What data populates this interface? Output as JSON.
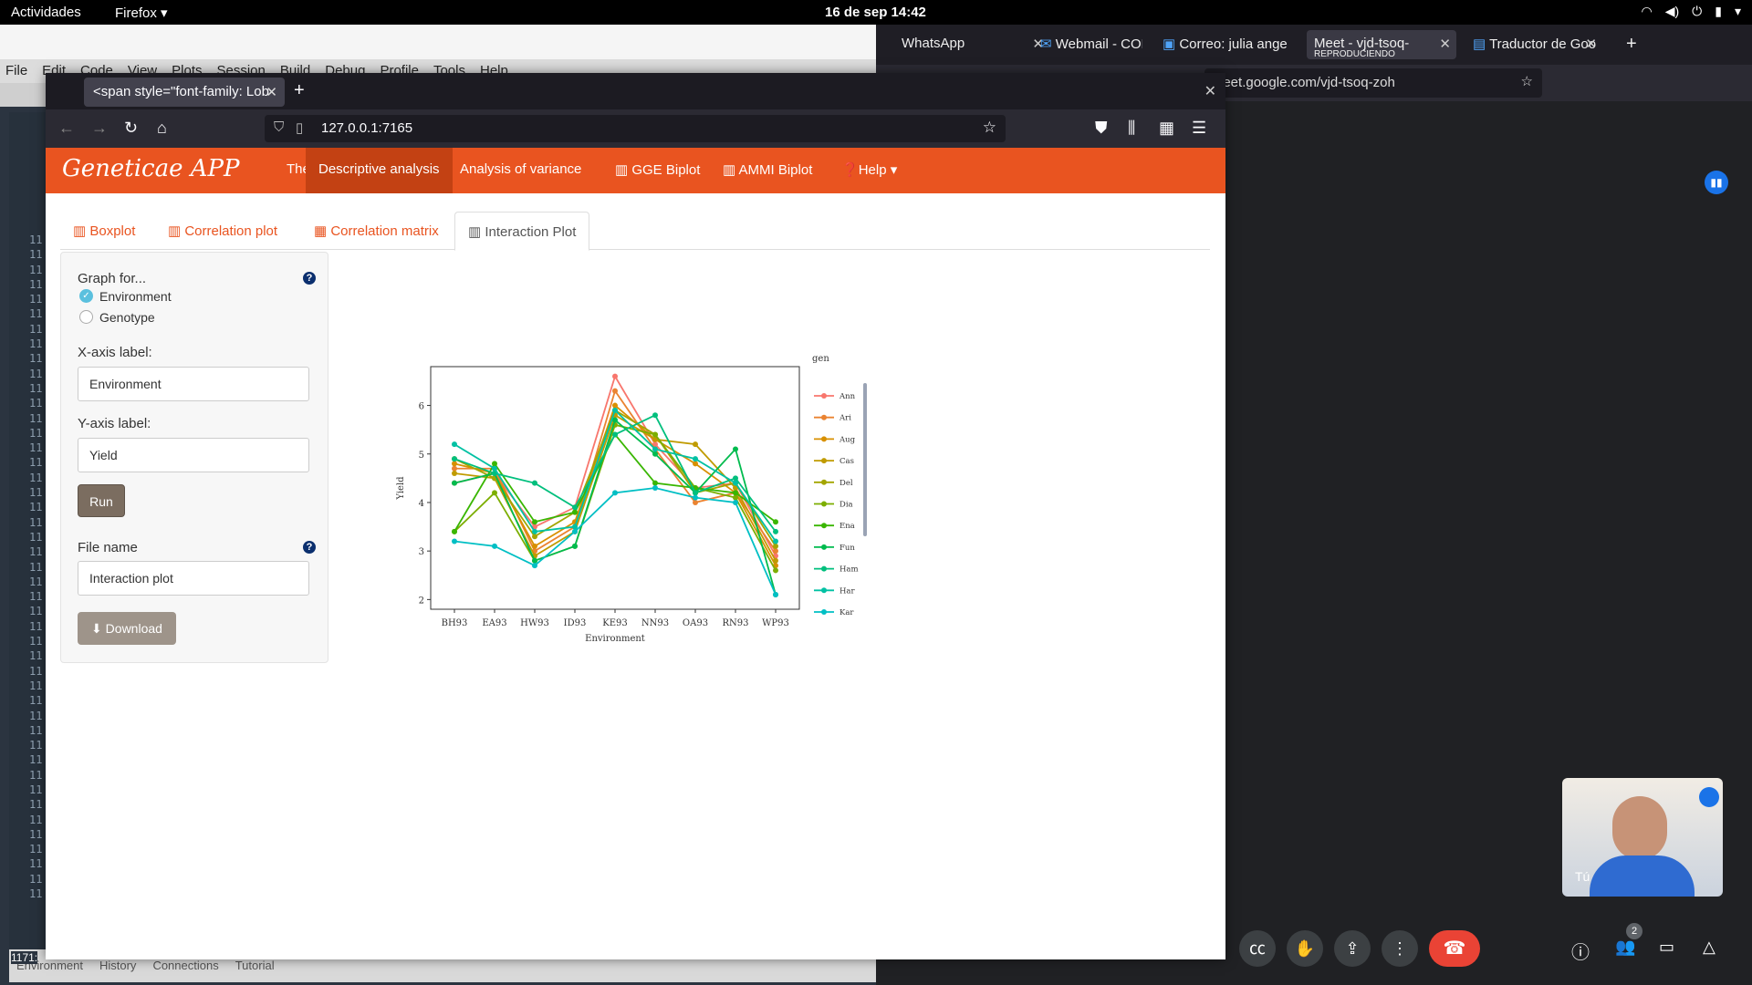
{
  "topbar": {
    "activities": "Actividades",
    "app": "Firefox ▾",
    "clock": "16 de sep  14:42"
  },
  "rstudio": {
    "menu": [
      "File",
      "Edit",
      "Code",
      "View",
      "Plots",
      "Session",
      "Build",
      "Debug",
      "Profile",
      "Tools",
      "Help"
    ],
    "bottom_tabs": [
      "Environment",
      "History",
      "Connections",
      "Tutorial"
    ],
    "line_prefix": "11",
    "line_counter": "1171:"
  },
  "meet": {
    "tabs": [
      {
        "label": "WhatsApp"
      },
      {
        "label": "Webmail - CONI"
      },
      {
        "label": "Correo: julia ange"
      },
      {
        "label": "Meet - vjd-tsoq-",
        "sub": "REPRODUCIENDO"
      },
      {
        "label": "Traductor de Goo"
      }
    ],
    "url": "neet.google.com/vjd-tsoq-zoh",
    "self_label": "Tú",
    "participants_badge": "2"
  },
  "browser": {
    "tab_title": "<span style=\"font-family: Lob",
    "url": "127.0.0.1:7165"
  },
  "app": {
    "brand": "Geneticae APP",
    "nav": [
      "The data",
      "Descriptive analysis",
      "Analysis of variance",
      "GGE Biplot",
      "AMMI Biplot",
      "Help"
    ],
    "active_nav": "Descriptive analysis",
    "subtabs": [
      "Boxplot",
      "Correlation plot",
      "Correlation matrix",
      "Interaction Plot"
    ],
    "active_subtab": "Interaction Plot",
    "sidebar": {
      "graph_for": "Graph for...",
      "options": [
        "Environment",
        "Genotype"
      ],
      "selected": "Environment",
      "xlabel_label": "X-axis label:",
      "xlabel_value": "Environment",
      "ylabel_label": "Y-axis label:",
      "ylabel_value": "Yield",
      "run": "Run",
      "filename_label": "File name",
      "filename_value": "Interaction plot",
      "download": "Download"
    }
  },
  "colors": {
    "accent": "#e95420",
    "accent_dark": "#c34113"
  },
  "chart_data": {
    "type": "line",
    "xlabel": "Environment",
    "ylabel": "Yield",
    "legend_title": "gen",
    "legend_position": "right",
    "grid": false,
    "ylim": [
      1.8,
      6.8
    ],
    "yticks": [
      2,
      3,
      4,
      5,
      6
    ],
    "categories": [
      "BH93",
      "EA93",
      "HW93",
      "ID93",
      "KE93",
      "NN93",
      "OA93",
      "RN93",
      "WP93"
    ],
    "series": [
      {
        "name": "Ann",
        "color": "#f8766d",
        "values": [
          4.4,
          4.6,
          3.5,
          3.9,
          6.6,
          5.2,
          4.3,
          4.4,
          2.9
        ]
      },
      {
        "name": "Ari",
        "color": "#ea8331",
        "values": [
          4.7,
          4.7,
          3.0,
          3.5,
          6.3,
          5.1,
          4.0,
          4.2,
          3.0
        ]
      },
      {
        "name": "Aug",
        "color": "#d89000",
        "values": [
          4.8,
          4.6,
          3.1,
          3.6,
          6.0,
          5.3,
          4.8,
          4.2,
          2.7
        ]
      },
      {
        "name": "Cas",
        "color": "#c09b00",
        "values": [
          4.6,
          4.5,
          2.9,
          3.4,
          5.8,
          5.3,
          5.2,
          4.3,
          2.8
        ]
      },
      {
        "name": "Del",
        "color": "#a3a500",
        "values": [
          4.9,
          4.5,
          3.3,
          3.8,
          5.9,
          5.4,
          4.2,
          4.4,
          3.1
        ]
      },
      {
        "name": "Dia",
        "color": "#7cae00",
        "values": [
          3.4,
          4.2,
          2.8,
          3.1,
          5.6,
          5.4,
          4.3,
          4.1,
          2.6
        ]
      },
      {
        "name": "Ena",
        "color": "#39b600",
        "values": [
          3.4,
          4.8,
          3.6,
          3.8,
          5.4,
          4.4,
          4.3,
          4.2,
          3.6
        ]
      },
      {
        "name": "Fun",
        "color": "#00bb4e",
        "values": [
          4.4,
          4.6,
          2.8,
          3.1,
          5.7,
          5.0,
          4.2,
          5.1,
          2.1
        ]
      },
      {
        "name": "Ham",
        "color": "#00bf7d",
        "values": [
          4.9,
          4.6,
          4.4,
          3.9,
          5.4,
          5.8,
          4.2,
          4.5,
          3.4
        ]
      },
      {
        "name": "Har",
        "color": "#00c1a3",
        "values": [
          5.2,
          4.7,
          3.4,
          3.5,
          5.9,
          5.1,
          4.9,
          4.4,
          3.2
        ]
      },
      {
        "name": "Kar",
        "color": "#00bfc4",
        "values": [
          3.2,
          3.1,
          2.7,
          3.4,
          4.2,
          4.3,
          4.1,
          4.0,
          2.1
        ]
      }
    ]
  }
}
